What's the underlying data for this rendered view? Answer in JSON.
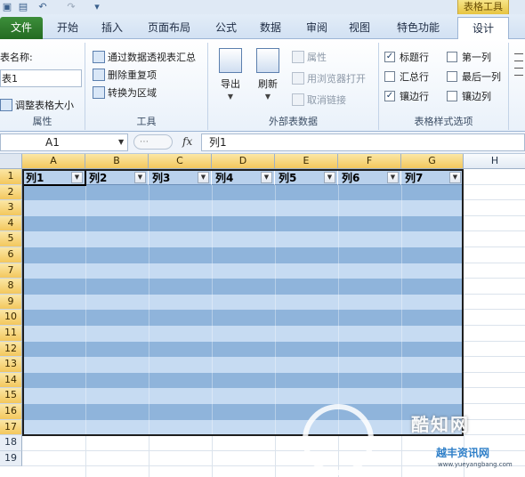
{
  "ribbon": {
    "contextual_group": "表格工具",
    "file_tab": "文件",
    "tabs": [
      "开始",
      "插入",
      "页面布局",
      "公式",
      "数据",
      "审阅",
      "视图",
      "特色功能",
      "设计"
    ],
    "active_tab": "设计",
    "properties": {
      "label_partial": "表名称:",
      "table_name_partial": "表1",
      "resize_partial": "调整表格大小",
      "group_label": "属性"
    },
    "tools": {
      "pivot": "通过数据透视表汇总",
      "remove_dup": "删除重复项",
      "convert": "转换为区域",
      "group_label": "工具"
    },
    "external": {
      "export": "导出",
      "refresh": "刷新",
      "properties": "属性",
      "open_browser": "用浏览器打开",
      "unlink": "取消链接",
      "group_label": "外部表数据"
    },
    "style_options": {
      "header_row": "标题行",
      "first_column": "第一列",
      "total_row": "汇总行",
      "last_column": "最后一列",
      "banded_rows": "镶边行",
      "banded_columns": "镶边列",
      "group_label": "表格样式选项",
      "header_row_checked": true,
      "first_column_checked": false,
      "total_row_checked": false,
      "last_column_checked": false,
      "banded_rows_checked": true,
      "banded_columns_checked": false
    }
  },
  "formula_bar": {
    "name_box": "A1",
    "fx": "fx",
    "content": "列1"
  },
  "sheet": {
    "columns": [
      "A",
      "B",
      "C",
      "D",
      "E",
      "F",
      "G",
      "H"
    ],
    "rows": [
      "1",
      "2",
      "3",
      "4",
      "5",
      "6",
      "7",
      "8",
      "9",
      "10",
      "11",
      "12",
      "13",
      "14",
      "15",
      "16",
      "17",
      "18",
      "19"
    ],
    "table_headers": [
      "列1",
      "列2",
      "列3",
      "列4",
      "列5",
      "列6",
      "列7"
    ]
  },
  "colors": {
    "band_dark": "#8fb4db",
    "band_light": "#c6dbf2",
    "selection_header": "#f3c75d",
    "file_tab": "#2f7d2c"
  },
  "watermark": {
    "line1": "酷知网",
    "line2": "越丰资讯网",
    "line3": "www.yueyangbang.com"
  }
}
